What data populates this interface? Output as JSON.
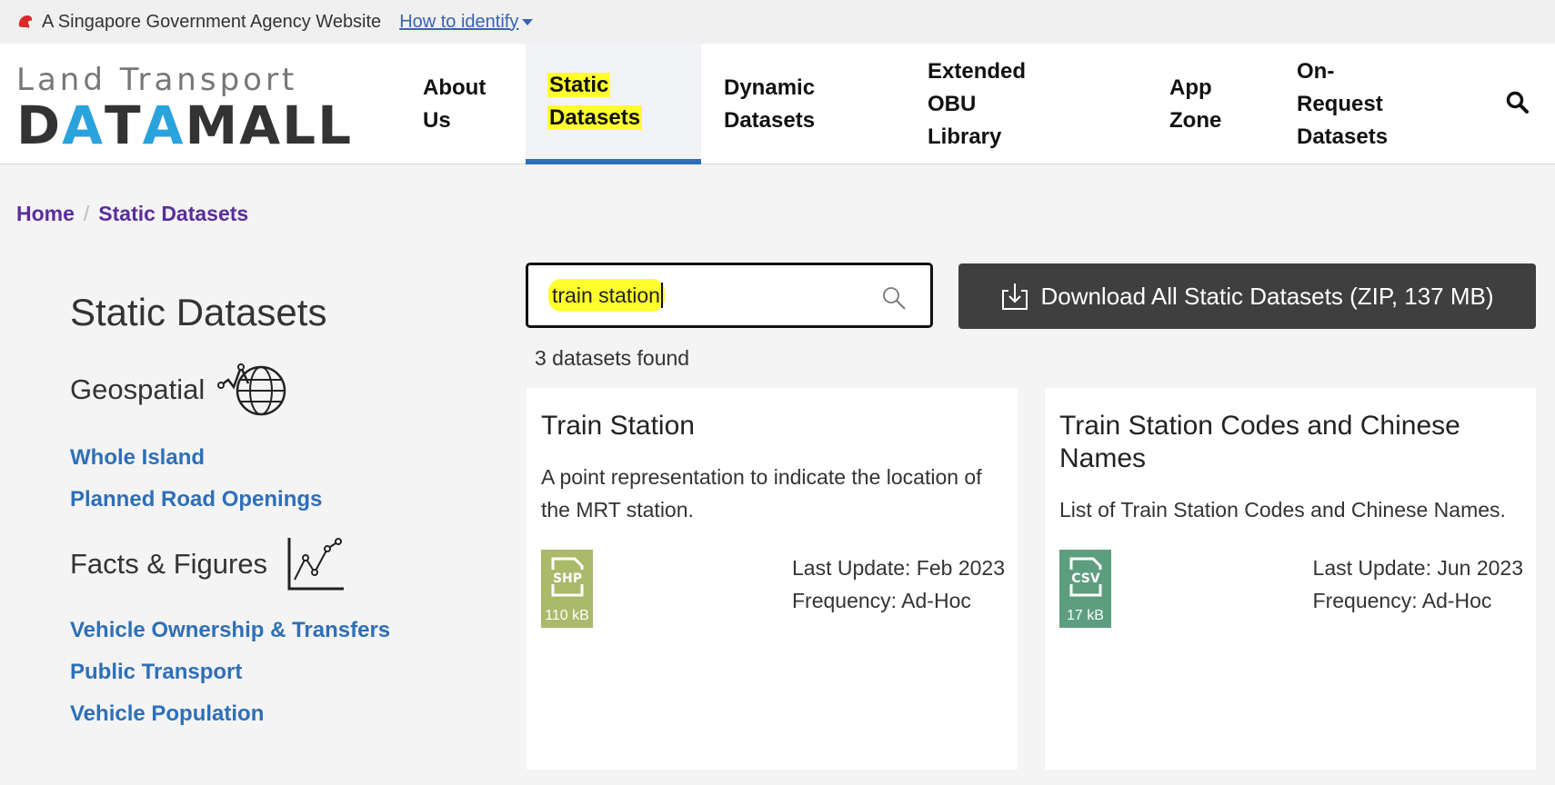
{
  "gov_bar": {
    "text": "A Singapore Government Agency Website",
    "identify_link": "How to identify"
  },
  "logo": {
    "line1": "Land Transport",
    "line2_part1": "D",
    "line2_a1": "A",
    "line2_part2": "T",
    "line2_a2": "A",
    "line2_part3": "MALL"
  },
  "nav": {
    "items": [
      {
        "line1": "About",
        "line2": "Us"
      },
      {
        "line1": "Static",
        "line2": "Datasets"
      },
      {
        "line1": "Dynamic",
        "line2": "Datasets"
      },
      {
        "line1": "Extended OBU",
        "line2": "Library"
      },
      {
        "line1": "App",
        "line2": "Zone"
      },
      {
        "line1": "On-Request",
        "line2": "Datasets"
      }
    ]
  },
  "breadcrumb": {
    "home": "Home",
    "current": "Static Datasets"
  },
  "sidebar": {
    "title": "Static Datasets",
    "sections": [
      {
        "label": "Geospatial",
        "icon": "globe-icon",
        "links": [
          "Whole Island",
          "Planned Road Openings"
        ]
      },
      {
        "label": "Facts & Figures",
        "icon": "line-chart-icon",
        "links": [
          "Vehicle Ownership & Transfers",
          "Public Transport",
          "Vehicle Population"
        ]
      }
    ]
  },
  "search": {
    "value": "train station"
  },
  "download_button": {
    "label": "Download All Static Datasets (ZIP, 137 MB)"
  },
  "results_count": "3 datasets found",
  "cards": [
    {
      "title": "Train Station",
      "description": "A point representation to indicate the location of the MRT station.",
      "file_type": "SHP",
      "file_size": "110 kB",
      "last_update": "Last Update: Feb 2023",
      "frequency": "Frequency: Ad-Hoc"
    },
    {
      "title": "Train Station Codes and Chinese Names",
      "description": "List of Train Station Codes and Chinese Names.",
      "file_type": "CSV",
      "file_size": "17 kB",
      "last_update": "Last Update: Jun 2023",
      "frequency": "Frequency: Ad-Hoc"
    }
  ],
  "colors": {
    "accent_blue": "#2e6fb8",
    "breadcrumb_purple": "#5a2d9c",
    "highlight": "#ffff2e",
    "button_dark": "#3f3f3f",
    "shp_badge": "#aab96a",
    "csv_badge": "#5d9e7f"
  }
}
